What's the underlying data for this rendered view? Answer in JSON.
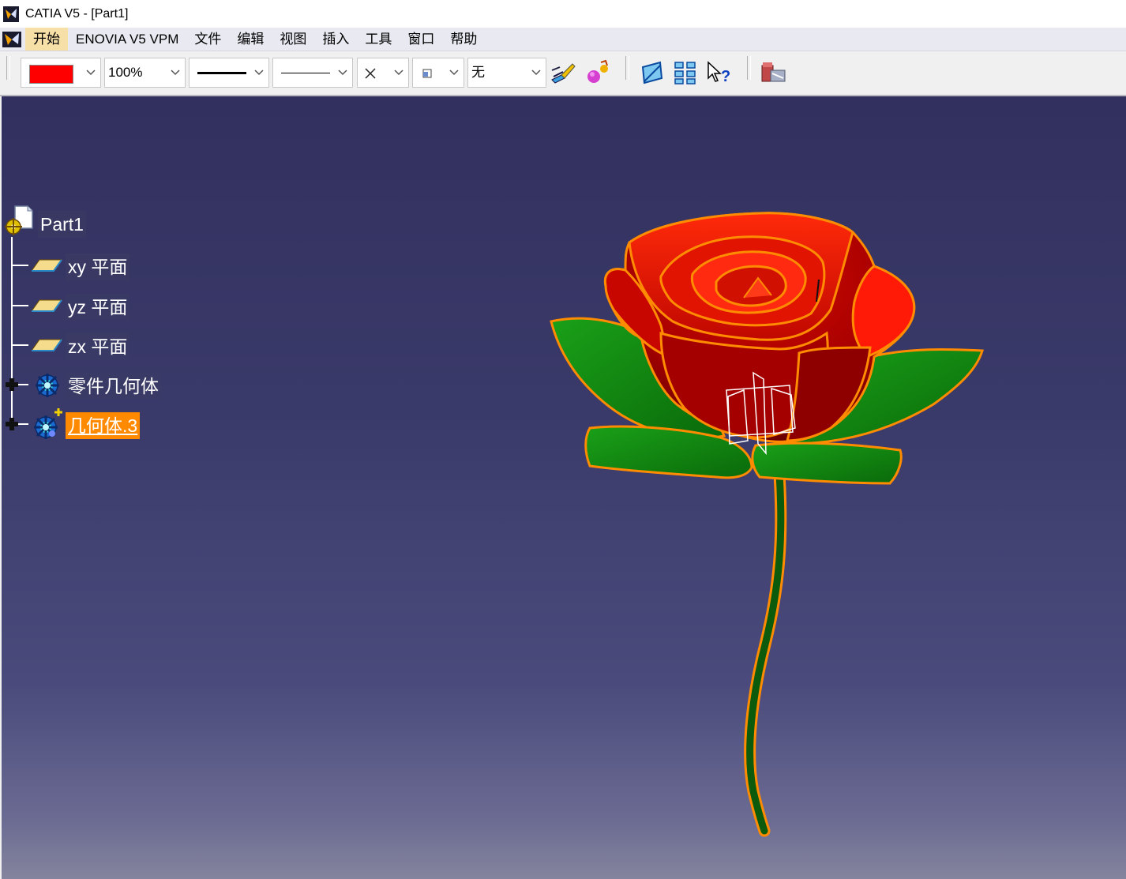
{
  "window": {
    "title": "CATIA V5 - [Part1]"
  },
  "menu": {
    "items": [
      "开始",
      "ENOVIA V5 VPM",
      "文件",
      "编辑",
      "视图",
      "插入",
      "工具",
      "窗口",
      "帮助"
    ]
  },
  "toolbar": {
    "color_swatch": "#ff0000",
    "transparency_value": "100%",
    "line_thickness_value": "——",
    "line_type_value": "———",
    "point_symbol_value": "×",
    "layer_value": "⊡",
    "rendering_value": "无"
  },
  "tree": {
    "root": "Part1",
    "nodes": [
      {
        "label": "xy 平面"
      },
      {
        "label": "yz 平面"
      },
      {
        "label": "zx 平面"
      },
      {
        "label": "零件几何体"
      },
      {
        "label": "几何体.3",
        "selected": true
      }
    ]
  },
  "colors": {
    "petal": "#e01800",
    "petal_dark": "#a80000",
    "leaf": "#118a10",
    "edge": "#ff8c00",
    "selection": "#ff8a00"
  }
}
